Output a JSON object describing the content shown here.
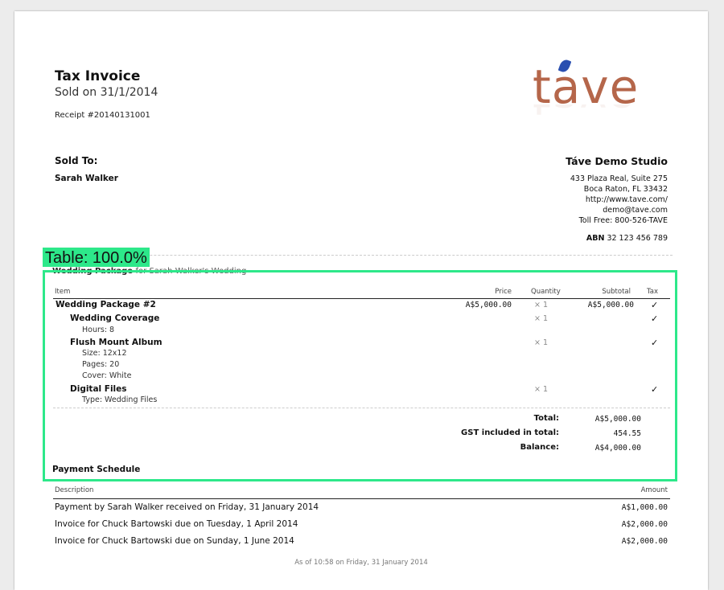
{
  "invoice": {
    "title": "Tax Invoice",
    "sold_on": "Sold on 31/1/2014",
    "receipt": "Receipt #20140131001"
  },
  "logo": {
    "text": "tave",
    "brand_color": "#b5664a",
    "leaf_color": "#2a4fb0"
  },
  "sold_to": {
    "label": "Sold To:",
    "name": "Sarah Walker"
  },
  "studio": {
    "name": "Táve Demo Studio",
    "address_lines": [
      "433 Plaza Real, Suite 275",
      "Boca Raton, FL 33432",
      "http://www.tave.com/",
      "demo@tave.com",
      "Toll Free: 800-526-TAVE"
    ],
    "abn_label": "ABN",
    "abn_value": "32 123 456 789"
  },
  "annotation": {
    "label": "Table: 100.0%",
    "color": "#2de88a"
  },
  "section": {
    "title": "Wedding Package",
    "subtitle": "for Sarah Walker's Wedding"
  },
  "table": {
    "headers": {
      "item": "Item",
      "price": "Price",
      "quantity": "Quantity",
      "subtotal": "Subtotal",
      "tax": "Tax"
    },
    "rows": [
      {
        "name": "Wedding Package #2",
        "price": "A$5,000.00",
        "qty": "× 1",
        "subtotal": "A$5,000.00",
        "tax": "✓"
      },
      {
        "name": "Wedding Coverage",
        "qty": "× 1",
        "tax": "✓",
        "details": [
          "Hours: 8"
        ]
      },
      {
        "name": "Flush Mount Album",
        "qty": "× 1",
        "tax": "✓",
        "details": [
          "Size: 12x12",
          "Pages: 20",
          "Cover: White"
        ]
      },
      {
        "name": "Digital Files",
        "qty": "× 1",
        "tax": "✓",
        "details": [
          "Type: Wedding Files"
        ]
      }
    ]
  },
  "totals": [
    {
      "label": "Total:",
      "value": "A$5,000.00"
    },
    {
      "label": "GST included in total:",
      "value": "454.55"
    },
    {
      "label": "Balance:",
      "value": "A$4,000.00"
    }
  ],
  "payments": {
    "title": "Payment Schedule",
    "headers": {
      "description": "Description",
      "amount": "Amount"
    },
    "rows": [
      {
        "description": "Payment by Sarah Walker received on Friday, 31 January 2014",
        "amount": "A$1,000.00"
      },
      {
        "description": "Invoice for Chuck Bartowski due on Tuesday, 1 April 2014",
        "amount": "A$2,000.00"
      },
      {
        "description": "Invoice for Chuck Bartowski due on Sunday, 1 June 2014",
        "amount": "A$2,000.00"
      }
    ]
  },
  "footer": "As of 10:58 on Friday, 31 January 2014"
}
